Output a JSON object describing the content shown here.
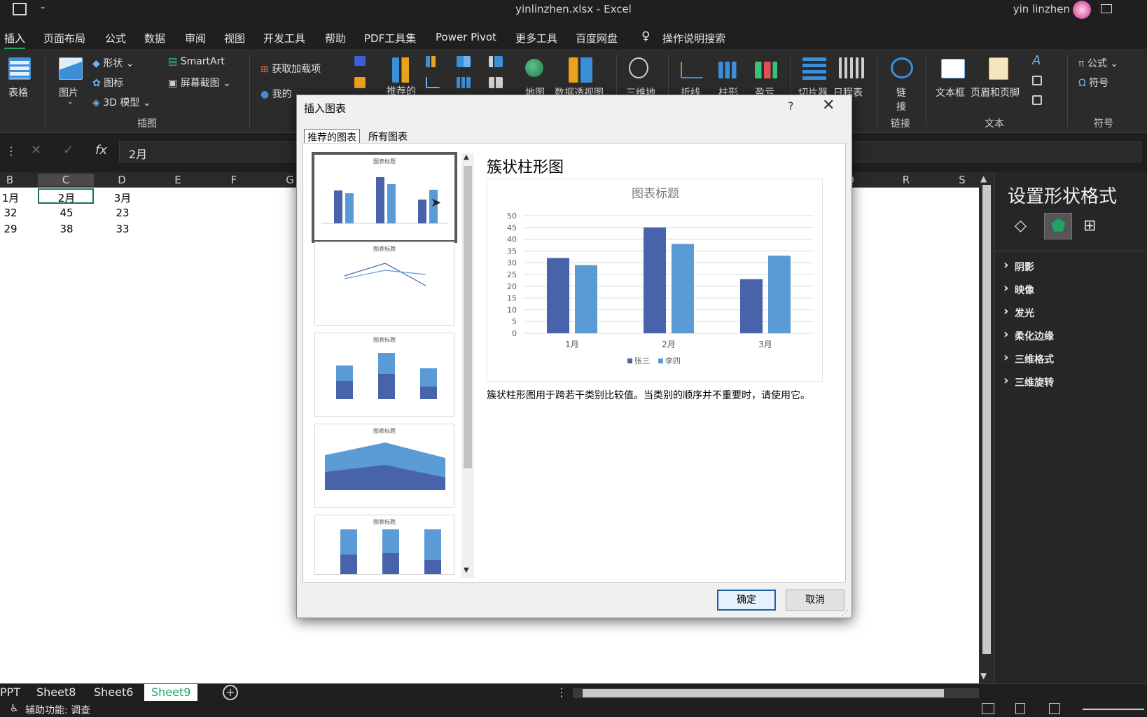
{
  "window": {
    "title": "yinlinzhen.xlsx  -  Excel",
    "user": "yin linzhen"
  },
  "ribbon_tabs": [
    "插入",
    "页面布局",
    "公式",
    "数据",
    "审阅",
    "视图",
    "开发工具",
    "帮助",
    "PDF工具集",
    "Power Pivot",
    "更多工具",
    "百度网盘",
    "操作说明搜索"
  ],
  "ribbon": {
    "table": "表格",
    "picture": "图片",
    "shape": "形状",
    "icon": "图标",
    "model3d": "3D 模型",
    "smartart": "SmartArt",
    "screenshot": "屏幕截图",
    "group_illustrations": "插图",
    "get_addins": "获取加载项",
    "my_addins": "我的",
    "recommended": "推荐的",
    "map": "地图",
    "pivotchart": "数据透视图",
    "map3d": "三维地",
    "line": "折线",
    "column": "柱形",
    "winloss": "盈亏",
    "slicer": "切片器",
    "timeline": "日程表",
    "link": "链",
    "link2": "接",
    "group_link": "链接",
    "textbox": "文本框",
    "headerfooter": "页眉和页脚",
    "group_text": "文本",
    "equation": "公式",
    "symbol": "符号",
    "group_symbols": "符号"
  },
  "formula_bar": {
    "value": "2月"
  },
  "columns": [
    "B",
    "C",
    "D",
    "E",
    "F",
    "G",
    "Q",
    "R",
    "S"
  ],
  "cells": {
    "row1": [
      "1月",
      "2月",
      "3月"
    ],
    "row2": [
      "32",
      "45",
      "23"
    ],
    "row3": [
      "29",
      "38",
      "33"
    ]
  },
  "sheet_tabs": [
    "PPT",
    "Sheet8",
    "Sheet6",
    "Sheet9"
  ],
  "status": "辅助功能: 调查",
  "pane": {
    "title": "设置形状格式",
    "items": [
      "阴影",
      "映像",
      "发光",
      "柔化边缘",
      "三维格式",
      "三维旋转"
    ]
  },
  "dialog": {
    "title": "插入图表",
    "help": "?",
    "tabs": [
      "推荐的图表",
      "所有图表"
    ],
    "thumb_title": "图表标题",
    "selected_name": "簇状柱形图",
    "description": "簇状柱形图用于跨若干类别比较值。当类别的顺序并不重要时，请使用它。",
    "ok": "确定",
    "cancel": "取消"
  },
  "colors": {
    "series1": "#4863aa",
    "series2": "#5b9bd5",
    "accent": "#21a366"
  },
  "chart_data": {
    "type": "bar",
    "title": "图表标题",
    "categories": [
      "1月",
      "2月",
      "3月"
    ],
    "series": [
      {
        "name": "张三",
        "values": [
          32,
          45,
          23
        ]
      },
      {
        "name": "李四",
        "values": [
          29,
          38,
          33
        ]
      }
    ],
    "ylim": [
      0,
      50
    ],
    "yticks": [
      0,
      5,
      10,
      15,
      20,
      25,
      30,
      35,
      40,
      45,
      50
    ],
    "grid": true,
    "legend": "bottom"
  }
}
